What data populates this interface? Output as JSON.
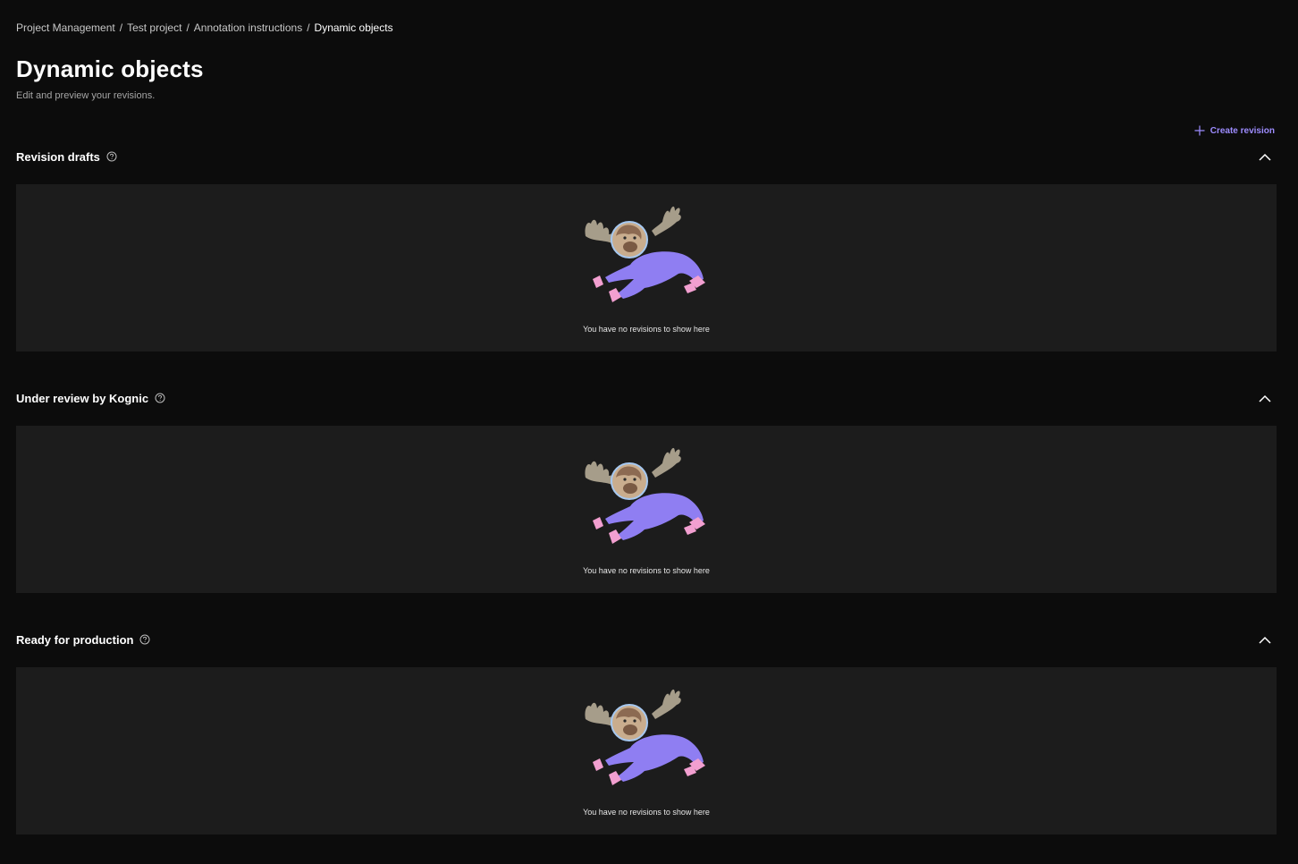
{
  "breadcrumb": {
    "items": [
      "Project Management",
      "Test project",
      "Annotation instructions"
    ],
    "current": "Dynamic objects",
    "separator": "/"
  },
  "page": {
    "title": "Dynamic objects",
    "subtitle": "Edit and preview your revisions."
  },
  "actions": {
    "create_revision": "Create revision"
  },
  "sections": [
    {
      "title": "Revision drafts",
      "empty_text": "You have no revisions to show here",
      "expanded": true
    },
    {
      "title": "Under review by Kognic",
      "empty_text": "You have no revisions to show here",
      "expanded": true
    },
    {
      "title": "Ready for production",
      "empty_text": "You have no revisions to show here",
      "expanded": true
    }
  ],
  "colors": {
    "background": "#0c0c0c",
    "panel": "#1c1c1c",
    "accent": "#9d8cff",
    "moose_body": "#8f7ef2",
    "moose_feet": "#f29fd0"
  },
  "icons": {
    "help": "help-circle-icon",
    "collapse": "chevron-up-icon",
    "add": "plus-icon",
    "empty_state": "flying-moose-illustration"
  }
}
